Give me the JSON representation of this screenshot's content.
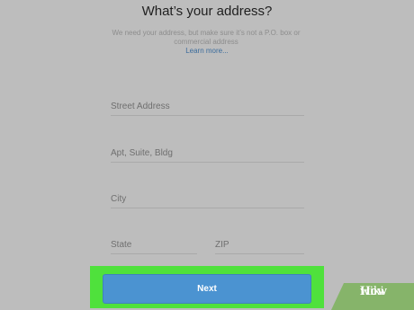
{
  "header": {
    "title": "What’s your address?",
    "subtitle": "We need your address, but make sure it’s not a P.O. box or commercial address",
    "learn_more": "Learn more..."
  },
  "form": {
    "street_placeholder": "Street Address",
    "apt_placeholder": "Apt, Suite, Bldg",
    "city_placeholder": "City",
    "state_placeholder": "State",
    "zip_placeholder": "ZIP"
  },
  "actions": {
    "next_label": "Next"
  },
  "watermark": {
    "wiki": "wiki",
    "how": "How"
  }
}
